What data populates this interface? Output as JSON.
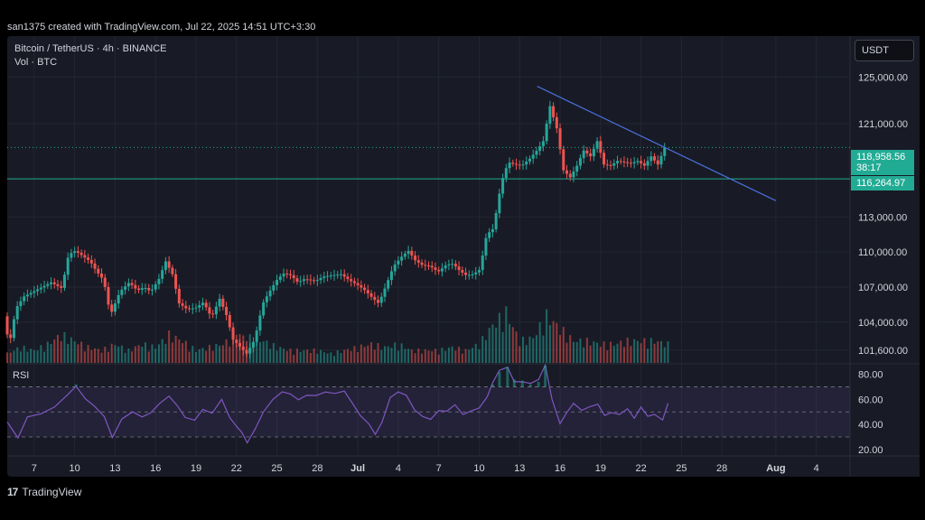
{
  "credit": "san1375 created with TradingView.com, Jul 22, 2025 14:51 UTC+3:30",
  "legend": {
    "symbol": "Bitcoin / TetherUS · 4h · BINANCE",
    "volume": "Vol · BTC"
  },
  "unit_button": "USDT",
  "rsi_label": "RSI",
  "footer": {
    "logo_glyph": "17",
    "brand": "TradingView"
  },
  "colors": {
    "up": "#26a69a",
    "down": "#ef5350",
    "trendline": "#4a6fdc",
    "support": "#22ab94",
    "rsi": "#7e57c2",
    "panel": "#181b25"
  },
  "price_tags": {
    "last_price": "118,958.56",
    "countdown": "38:17",
    "support_price": "116,264.97"
  },
  "chart_data": [
    {
      "type": "candlestick",
      "title": "Bitcoin / TetherUS · 4h · BINANCE",
      "y_axis_ticks": [
        {
          "label": "125,000.00",
          "value": 125000
        },
        {
          "label": "121,000.00",
          "value": 121000
        },
        {
          "label": "113,000.00",
          "value": 113000
        },
        {
          "label": "110,000.00",
          "value": 110000
        },
        {
          "label": "107,000.00",
          "value": 107000
        },
        {
          "label": "104,000.00",
          "value": 104000
        },
        {
          "label": "101,600.00",
          "value": 101600
        }
      ],
      "ylim": [
        100500,
        128500
      ],
      "x_axis_ticks": [
        {
          "label": "7",
          "day": 7
        },
        {
          "label": "10",
          "day": 10
        },
        {
          "label": "13",
          "day": 13
        },
        {
          "label": "16",
          "day": 16
        },
        {
          "label": "19",
          "day": 19
        },
        {
          "label": "22",
          "day": 22
        },
        {
          "label": "25",
          "day": 25
        },
        {
          "label": "28",
          "day": 28
        },
        {
          "label": "Jul",
          "day": 31
        },
        {
          "label": "4",
          "day": 34
        },
        {
          "label": "7",
          "day": 37
        },
        {
          "label": "10",
          "day": 40
        },
        {
          "label": "13",
          "day": 43
        },
        {
          "label": "16",
          "day": 46
        },
        {
          "label": "19",
          "day": 49
        },
        {
          "label": "22",
          "day": 52
        },
        {
          "label": "25",
          "day": 55
        },
        {
          "label": "28",
          "day": 58
        },
        {
          "label": "Aug",
          "day": 62
        },
        {
          "label": "4",
          "day": 65
        }
      ],
      "xlim": [
        5,
        67.5
      ],
      "price_path": [
        [
          5.0,
          104500
        ],
        [
          5.4,
          102000
        ],
        [
          5.9,
          105200
        ],
        [
          6.5,
          106200
        ],
        [
          7.5,
          106800
        ],
        [
          8.5,
          107400
        ],
        [
          9.3,
          106900
        ],
        [
          9.8,
          109800
        ],
        [
          10.3,
          110100
        ],
        [
          10.8,
          109700
        ],
        [
          11.4,
          109200
        ],
        [
          11.9,
          108300
        ],
        [
          12.4,
          107600
        ],
        [
          12.9,
          104600
        ],
        [
          13.6,
          106600
        ],
        [
          14.3,
          107400
        ],
        [
          14.9,
          106700
        ],
        [
          15.4,
          107000
        ],
        [
          15.9,
          106600
        ],
        [
          16.5,
          107700
        ],
        [
          17.0,
          109200
        ],
        [
          17.5,
          108100
        ],
        [
          18.0,
          105600
        ],
        [
          18.6,
          105100
        ],
        [
          19.2,
          105200
        ],
        [
          19.8,
          105700
        ],
        [
          20.4,
          104400
        ],
        [
          21.0,
          106000
        ],
        [
          21.5,
          104600
        ],
        [
          22.0,
          102500
        ],
        [
          22.5,
          101900
        ],
        [
          23.0,
          101300
        ],
        [
          23.6,
          102500
        ],
        [
          24.2,
          105600
        ],
        [
          24.8,
          106800
        ],
        [
          25.3,
          107700
        ],
        [
          25.8,
          108200
        ],
        [
          26.3,
          108000
        ],
        [
          26.8,
          107400
        ],
        [
          27.3,
          107700
        ],
        [
          28.1,
          107500
        ],
        [
          28.7,
          107900
        ],
        [
          29.3,
          108000
        ],
        [
          30.0,
          108100
        ],
        [
          30.6,
          107600
        ],
        [
          31.2,
          107200
        ],
        [
          31.8,
          106700
        ],
        [
          32.3,
          106100
        ],
        [
          32.8,
          105600
        ],
        [
          33.4,
          107300
        ],
        [
          33.9,
          108800
        ],
        [
          34.5,
          109600
        ],
        [
          35.0,
          110100
        ],
        [
          35.5,
          109300
        ],
        [
          36.0,
          108900
        ],
        [
          36.6,
          108800
        ],
        [
          37.2,
          108300
        ],
        [
          37.8,
          108900
        ],
        [
          38.3,
          109000
        ],
        [
          38.8,
          108400
        ],
        [
          39.3,
          108000
        ],
        [
          39.8,
          108100
        ],
        [
          40.3,
          108500
        ],
        [
          40.8,
          111500
        ],
        [
          41.3,
          112000
        ],
        [
          41.9,
          116000
        ],
        [
          42.4,
          117700
        ],
        [
          42.9,
          117500
        ],
        [
          43.4,
          117400
        ],
        [
          44.0,
          118000
        ],
        [
          44.6,
          118800
        ],
        [
          45.0,
          119500
        ],
        [
          45.5,
          122500
        ],
        [
          46.0,
          120600
        ],
        [
          46.5,
          117000
        ],
        [
          47.0,
          116400
        ],
        [
          47.5,
          117400
        ],
        [
          48.0,
          118700
        ],
        [
          48.5,
          118200
        ],
        [
          49.0,
          119500
        ],
        [
          49.5,
          117500
        ],
        [
          50.0,
          117400
        ],
        [
          50.5,
          117800
        ],
        [
          51.0,
          117700
        ],
        [
          51.5,
          117600
        ],
        [
          52.0,
          117800
        ],
        [
          52.5,
          117400
        ],
        [
          53.0,
          118200
        ],
        [
          53.5,
          117500
        ],
        [
          54.0,
          118958
        ]
      ],
      "volume_path": [
        [
          5.0,
          0.15
        ],
        [
          6.0,
          0.25
        ],
        [
          7.0,
          0.2
        ],
        [
          8.0,
          0.3
        ],
        [
          9.0,
          0.45
        ],
        [
          10.0,
          0.35
        ],
        [
          11.0,
          0.25
        ],
        [
          12.0,
          0.2
        ],
        [
          13.0,
          0.3
        ],
        [
          14.0,
          0.2
        ],
        [
          15.0,
          0.3
        ],
        [
          16.0,
          0.25
        ],
        [
          17.0,
          0.45
        ],
        [
          18.0,
          0.35
        ],
        [
          19.0,
          0.2
        ],
        [
          20.0,
          0.25
        ],
        [
          21.0,
          0.3
        ],
        [
          22.0,
          0.45
        ],
        [
          23.0,
          0.4
        ],
        [
          24.0,
          0.35
        ],
        [
          25.0,
          0.25
        ],
        [
          26.0,
          0.2
        ],
        [
          27.0,
          0.2
        ],
        [
          28.0,
          0.2
        ],
        [
          29.0,
          0.15
        ],
        [
          30.0,
          0.2
        ],
        [
          31.0,
          0.25
        ],
        [
          32.0,
          0.3
        ],
        [
          33.0,
          0.25
        ],
        [
          34.0,
          0.3
        ],
        [
          35.0,
          0.2
        ],
        [
          36.0,
          0.2
        ],
        [
          37.0,
          0.2
        ],
        [
          38.0,
          0.25
        ],
        [
          39.0,
          0.2
        ],
        [
          40.0,
          0.3
        ],
        [
          41.0,
          0.6
        ],
        [
          42.0,
          0.8
        ],
        [
          43.0,
          0.35
        ],
        [
          44.0,
          0.4
        ],
        [
          45.0,
          0.75
        ],
        [
          46.0,
          0.55
        ],
        [
          47.0,
          0.35
        ],
        [
          48.0,
          0.35
        ],
        [
          49.0,
          0.3
        ],
        [
          50.0,
          0.3
        ],
        [
          51.0,
          0.35
        ],
        [
          52.0,
          0.35
        ],
        [
          53.0,
          0.35
        ],
        [
          54.0,
          0.3
        ]
      ],
      "trendline": {
        "from": [
          44.3,
          124200
        ],
        "to": [
          62.0,
          114400
        ]
      },
      "support_level": 116264.97,
      "last_price": 118958.56
    },
    {
      "type": "line",
      "title": "RSI",
      "y_axis_ticks": [
        {
          "label": "80.00",
          "value": 80
        },
        {
          "label": "60.00",
          "value": 60
        },
        {
          "label": "40.00",
          "value": 40
        },
        {
          "label": "20.00",
          "value": 20
        }
      ],
      "ylim": [
        17,
        87
      ],
      "bands": [
        70,
        50,
        30
      ],
      "series": [
        {
          "values": [
            [
              5,
              40
            ],
            [
              5.8,
              28
            ],
            [
              6.5,
              45
            ],
            [
              7.5,
              50
            ],
            [
              8.5,
              52
            ],
            [
              9.5,
              66
            ],
            [
              10.1,
              72
            ],
            [
              10.8,
              62
            ],
            [
              11.5,
              56
            ],
            [
              12.2,
              48
            ],
            [
              12.8,
              30
            ],
            [
              13.5,
              45
            ],
            [
              14.3,
              52
            ],
            [
              15,
              48
            ],
            [
              15.6,
              50
            ],
            [
              16.3,
              58
            ],
            [
              17,
              64
            ],
            [
              17.6,
              55
            ],
            [
              18.2,
              44
            ],
            [
              18.9,
              42
            ],
            [
              19.5,
              50
            ],
            [
              20.2,
              47
            ],
            [
              20.9,
              58
            ],
            [
              21.5,
              44
            ],
            [
              22,
              40
            ],
            [
              22.4,
              33
            ],
            [
              22.8,
              25
            ],
            [
              23.4,
              38
            ],
            [
              24,
              52
            ],
            [
              24.7,
              62
            ],
            [
              25.4,
              68
            ],
            [
              26,
              66
            ],
            [
              26.6,
              60
            ],
            [
              27.2,
              62
            ],
            [
              27.9,
              62
            ],
            [
              28.6,
              65
            ],
            [
              29.3,
              64
            ],
            [
              30,
              66
            ],
            [
              30.6,
              55
            ],
            [
              31.2,
              45
            ],
            [
              31.8,
              40
            ],
            [
              32.3,
              34
            ],
            [
              32.8,
              42
            ],
            [
              33.4,
              60
            ],
            [
              34,
              64
            ],
            [
              34.6,
              62
            ],
            [
              35.2,
              52
            ],
            [
              35.8,
              48
            ],
            [
              36.4,
              46
            ],
            [
              37,
              52
            ],
            [
              37.6,
              50
            ],
            [
              38.2,
              54
            ],
            [
              38.8,
              46
            ],
            [
              39.4,
              50
            ],
            [
              40,
              54
            ],
            [
              40.6,
              64
            ],
            [
              41,
              72
            ],
            [
              41.5,
              82
            ],
            [
              42.1,
              86
            ],
            [
              42.6,
              76
            ],
            [
              43.2,
              75
            ],
            [
              43.8,
              72
            ],
            [
              44.4,
              74
            ],
            [
              44.9,
              87
            ],
            [
              45.4,
              62
            ],
            [
              46,
              42
            ],
            [
              46.5,
              48
            ],
            [
              47,
              56
            ],
            [
              47.6,
              52
            ],
            [
              48.2,
              56
            ],
            [
              48.8,
              58
            ],
            [
              49.3,
              46
            ],
            [
              49.8,
              48
            ],
            [
              50.4,
              48
            ],
            [
              51,
              54
            ],
            [
              51.5,
              46
            ],
            [
              52,
              52
            ],
            [
              52.5,
              46
            ],
            [
              53,
              50
            ],
            [
              53.6,
              45
            ],
            [
              54,
              55
            ]
          ]
        }
      ]
    }
  ]
}
